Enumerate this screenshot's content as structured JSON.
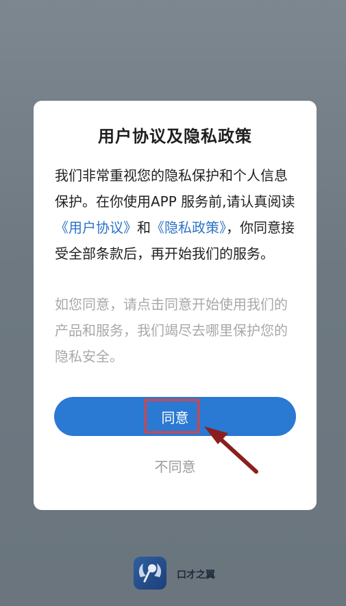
{
  "dialog": {
    "title": "用户协议及隐私政策",
    "body_text_part1": "我们非常重视您的隐私保护和个人信息保护。在你使用APP 服务前,请认真阅读",
    "link_user_agreement": "《用户协议》",
    "body_text_part2": "和",
    "link_privacy_policy": "《隐私政策》",
    "body_text_part3": "，你同意接受全部条款后，再开始我们的服务。",
    "note": "如您同意，请点击同意开始使用我们的产品和服务，我们竭尽去哪里保护您的隐私安全。",
    "agree_label": "同意",
    "disagree_label": "不同意"
  },
  "footer": {
    "app_name": "口才之翼",
    "logo_icon": "mic-wings-logo"
  },
  "colors": {
    "accent": "#2a79d3",
    "highlight": "#e04040",
    "arrow": "#8a1f1f"
  }
}
